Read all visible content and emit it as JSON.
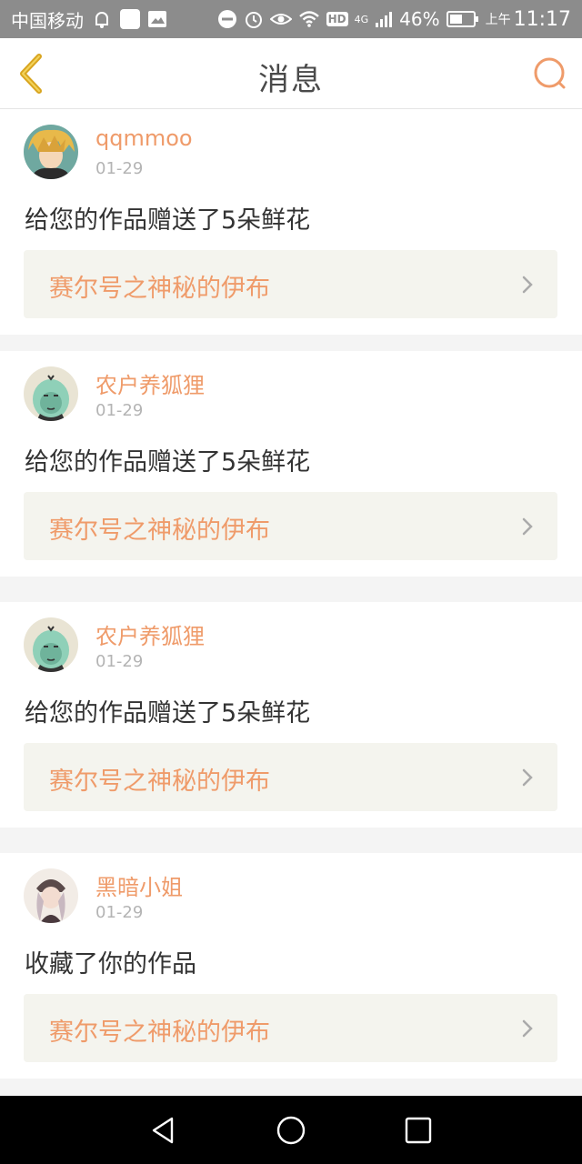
{
  "status_bar": {
    "carrier": "中国移动",
    "network": "4G",
    "hd": "HD",
    "battery_percent": "46%",
    "ampm": "上午",
    "time": "11:17"
  },
  "header": {
    "title": "消息"
  },
  "colors": {
    "accent": "#ef9b6a",
    "back_arrow": "#d9a520",
    "link_background": "#f4f4ee"
  },
  "messages": [
    {
      "username": "qqmmoo",
      "date": "01-29",
      "text": "给您的作品赠送了5朵鲜花",
      "work_title": "赛尔号之神秘的伊布"
    },
    {
      "username": "农户养狐狸",
      "date": "01-29",
      "text": "给您的作品赠送了5朵鲜花",
      "work_title": "赛尔号之神秘的伊布"
    },
    {
      "username": "农户养狐狸",
      "date": "01-29",
      "text": "给您的作品赠送了5朵鲜花",
      "work_title": "赛尔号之神秘的伊布"
    },
    {
      "username": "黑暗小姐",
      "date": "01-29",
      "text": "收藏了你的作品",
      "work_title": "赛尔号之神秘的伊布"
    }
  ]
}
